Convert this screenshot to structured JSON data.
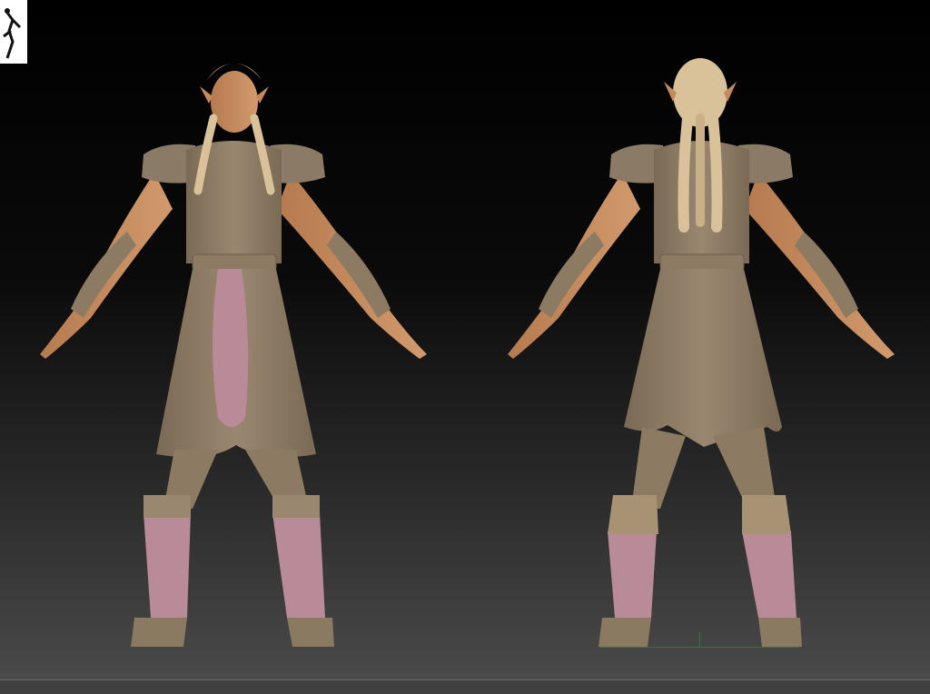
{
  "viewport": {
    "background_top": "#000000",
    "background_bottom": "#4a4a4a"
  },
  "model": {
    "skin_color": "#c48a5c",
    "cloth_color": "#8c7a62",
    "hair_color": "#d9c29a",
    "accent_color": "#b98a98",
    "views": [
      "front",
      "back"
    ]
  },
  "icons": {
    "nav_thumbnail": "figure-thumbnail-icon",
    "floor_axis": "floor-grid-icon"
  }
}
